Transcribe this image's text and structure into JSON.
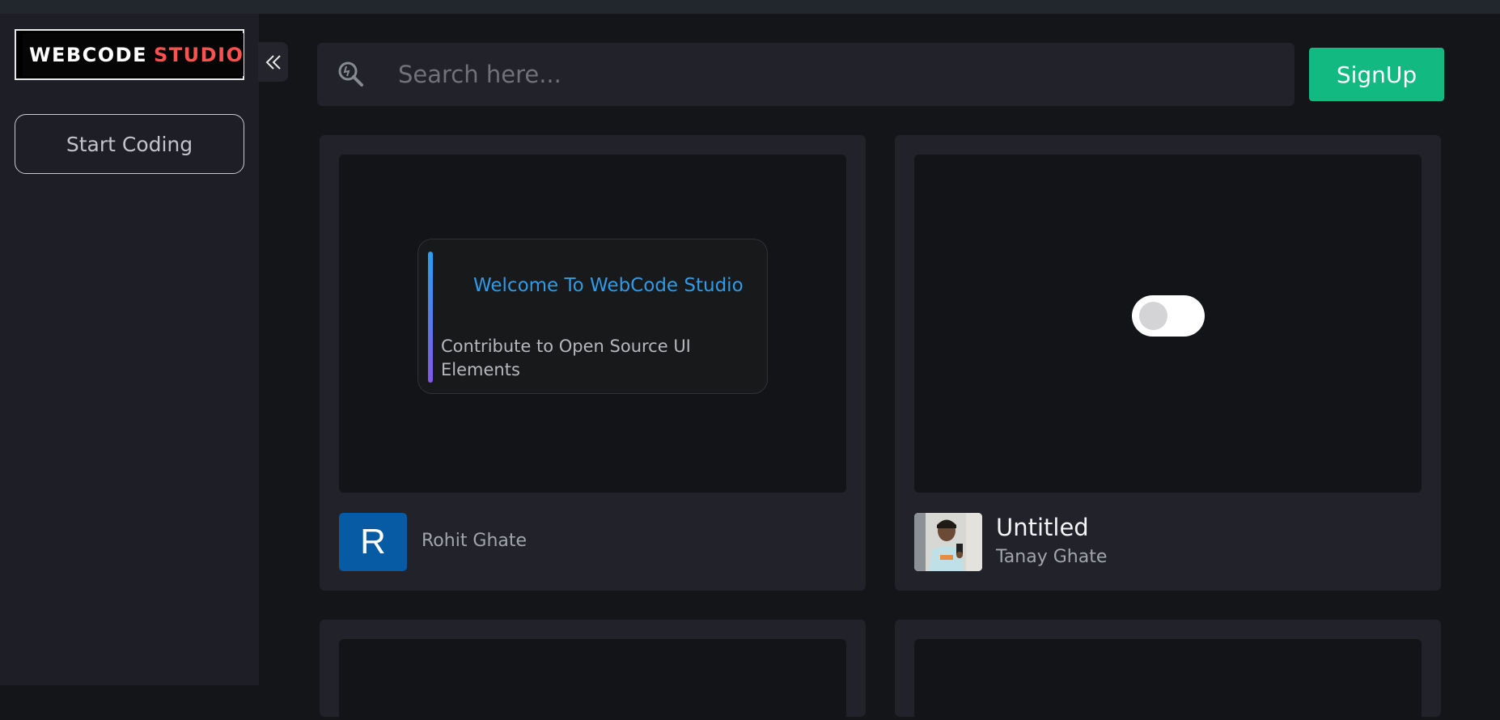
{
  "logo": {
    "part1": "WEBCODE",
    "part2": "STUDIO"
  },
  "sidebar": {
    "start_coding_label": "Start Coding"
  },
  "search": {
    "placeholder": "Search here..."
  },
  "header": {
    "signup_label": "SignUp"
  },
  "cards": [
    {
      "preview": {
        "title": "Welcome To WebCode Studio",
        "subtitle": "Contribute to Open Source UI Elements"
      },
      "avatar_letter": "R",
      "author": "Rohit Ghate"
    },
    {
      "title": "Untitled",
      "author": "Tanay Ghate"
    }
  ],
  "colors": {
    "accent": "#12b981",
    "logo_red": "#ff4f4f",
    "welcome_blue": "#2e9be9",
    "avatar_blue": "#075aa4"
  }
}
